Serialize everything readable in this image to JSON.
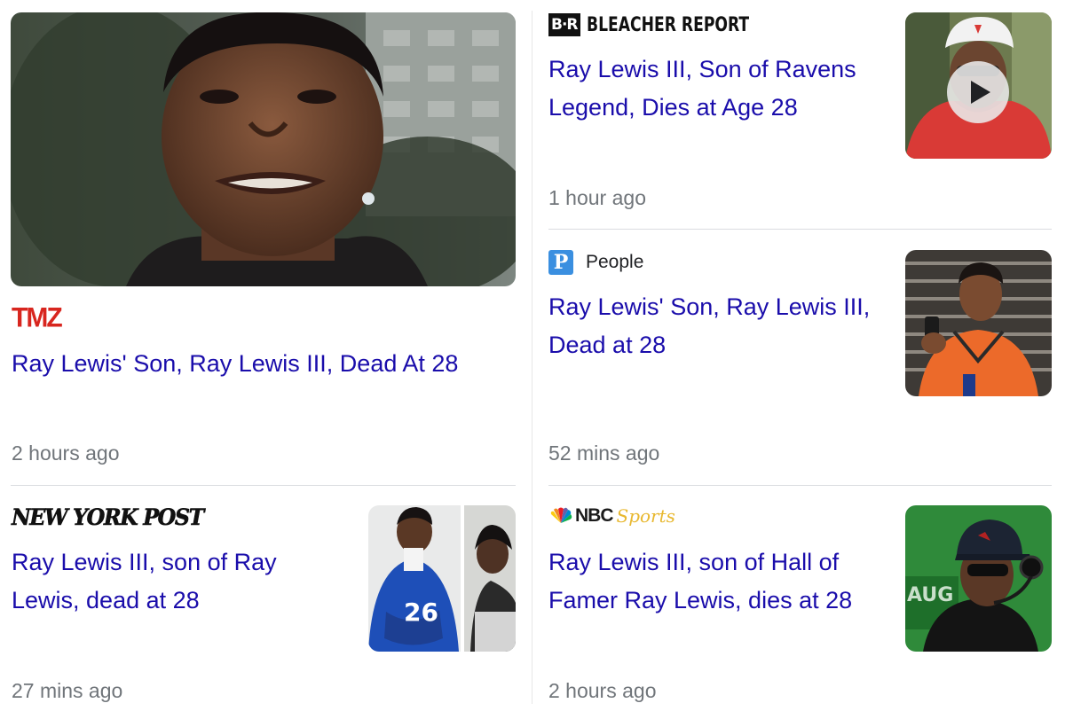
{
  "articles": [
    {
      "source": "TMZ",
      "headline": "Ray Lewis' Son, Ray Lewis III, Dead At 28",
      "time": "2 hours ago"
    },
    {
      "source": "BLEACHER REPORT",
      "source_badge": "B·R",
      "headline": "Ray Lewis III, Son of Ravens Legend, Dies at Age 28",
      "time": "1 hour ago"
    },
    {
      "source": "People",
      "source_badge": "P",
      "headline": "Ray Lewis' Son, Ray Lewis III, Dead at 28",
      "time": "52 mins ago"
    },
    {
      "source": "NEW YORK POST",
      "headline": "Ray Lewis III, son of Ray Lewis, dead at 28",
      "time": "27 mins ago"
    },
    {
      "source": "NBC",
      "source_suffix": "Sports",
      "headline": "Ray Lewis III, son of Hall of Famer Ray Lewis, dies at 28",
      "time": "2 hours ago"
    }
  ],
  "colors": {
    "headline": "#1a0dab",
    "time": "#70757a",
    "tmz": "#d8261f",
    "people": "#3a8fe0",
    "nbc_sports": "#e8b830"
  },
  "icons": {
    "video": "play-icon",
    "nbc": "peacock-icon"
  }
}
